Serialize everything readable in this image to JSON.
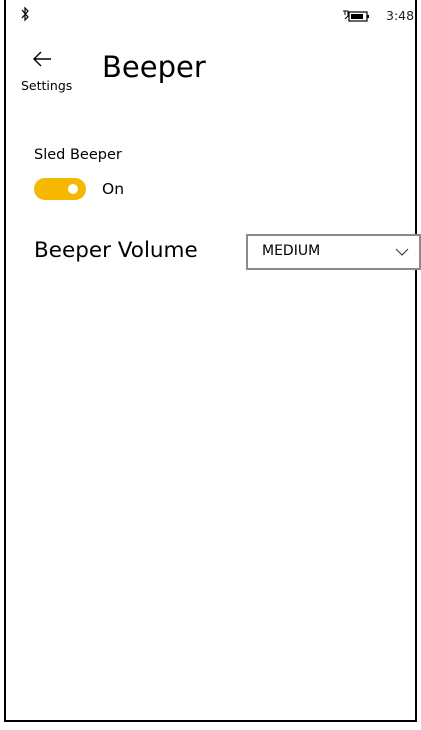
{
  "status_bar": {
    "time": "3:48",
    "icons": [
      "bluetooth-icon",
      "battery-icon"
    ]
  },
  "header": {
    "back_label": "Settings",
    "title": "Beeper"
  },
  "sled_beeper": {
    "label": "Sled Beeper",
    "state_label": "On",
    "enabled": true
  },
  "beeper_volume": {
    "label": "Beeper Volume",
    "selected": "MEDIUM"
  },
  "colors": {
    "accent": "#f5b700",
    "border": "#8a8a8a"
  }
}
